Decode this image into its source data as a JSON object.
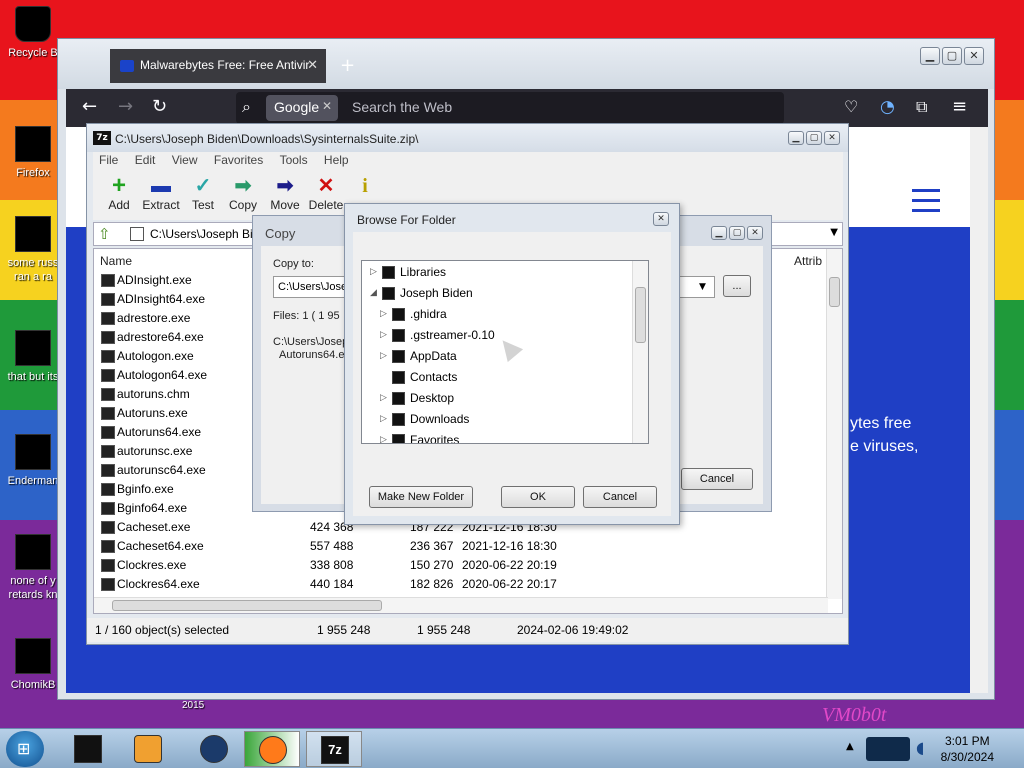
{
  "desktop": {
    "icons": [
      {
        "label": "Recycle B"
      },
      {
        "label": "Firefox"
      },
      {
        "label": "some russ ran a ra"
      },
      {
        "label": "that but its"
      },
      {
        "label": "Enderman"
      },
      {
        "label": "none of y retards kn"
      },
      {
        "label": "ChomikB"
      }
    ],
    "bg_text": "VM0b0t",
    "bg_text2": "2015"
  },
  "browser": {
    "tab_title": "Malwarebytes Free: Free Antivir",
    "tab_close": "✕",
    "new_tab": "+",
    "search_engine": "Google",
    "search_placeholder": "Search the Web",
    "site_text_line1": "ytes free",
    "site_text_line2": "e viruses,",
    "colors": {
      "site_blue": "#1f3fc5",
      "toolbar": "#2b2a33"
    }
  },
  "zip": {
    "title": "C:\\Users\\Joseph Biden\\Downloads\\SysinternalsSuite.zip\\",
    "logo": "7z",
    "menu": [
      "File",
      "Edit",
      "View",
      "Favorites",
      "Tools",
      "Help"
    ],
    "toolbar": [
      {
        "label": "Add",
        "icon": "+",
        "color": "#1fa31f"
      },
      {
        "label": "Extract",
        "icon": "▬",
        "color": "#1c3ab0"
      },
      {
        "label": "Test",
        "icon": "✓",
        "color": "#2aa6a6"
      },
      {
        "label": "Copy",
        "icon": "➡",
        "color": "#2a9a6a"
      },
      {
        "label": "Move",
        "icon": "➡",
        "color": "#1c1c8a"
      },
      {
        "label": "Delete",
        "icon": "✕",
        "color": "#d01010"
      },
      {
        "label": "Info",
        "icon": "i",
        "color": "#b8a000"
      }
    ],
    "path": "C:\\Users\\Joseph Bide",
    "columns": {
      "name": "Name",
      "attrib": "Attrib"
    },
    "files": [
      {
        "name": "ADInsight.exe",
        "size": "",
        "packed": "",
        "modified": ""
      },
      {
        "name": "ADInsight64.exe",
        "size": "",
        "packed": "",
        "modified": ""
      },
      {
        "name": "adrestore.exe",
        "size": "",
        "packed": "",
        "modified": ""
      },
      {
        "name": "adrestore64.exe",
        "size": "",
        "packed": "",
        "modified": ""
      },
      {
        "name": "Autologon.exe",
        "size": "",
        "packed": "",
        "modified": ""
      },
      {
        "name": "Autologon64.exe",
        "size": "",
        "packed": "",
        "modified": ""
      },
      {
        "name": "autoruns.chm",
        "size": "",
        "packed": "",
        "modified": ""
      },
      {
        "name": "Autoruns.exe",
        "size": "",
        "packed": "",
        "modified": ""
      },
      {
        "name": "Autoruns64.exe",
        "size": "",
        "packed": "",
        "modified": ""
      },
      {
        "name": "autorunsc.exe",
        "size": "",
        "packed": "",
        "modified": ""
      },
      {
        "name": "autorunsc64.exe",
        "size": "",
        "packed": "",
        "modified": ""
      },
      {
        "name": "Bginfo.exe",
        "size": "",
        "packed": "",
        "modified": ""
      },
      {
        "name": "Bginfo64.exe",
        "size": "",
        "packed": "",
        "modified": ""
      },
      {
        "name": "Cacheset.exe",
        "size": "424 368",
        "packed": "187 222",
        "modified": "2021-12-16 18:30"
      },
      {
        "name": "Cacheset64.exe",
        "size": "557 488",
        "packed": "236 367",
        "modified": "2021-12-16 18:30"
      },
      {
        "name": "Clockres.exe",
        "size": "338 808",
        "packed": "150 270",
        "modified": "2020-06-22 20:19"
      },
      {
        "name": "Clockres64.exe",
        "size": "440 184",
        "packed": "182 826",
        "modified": "2020-06-22 20:17"
      }
    ],
    "status": {
      "selected": "1 / 160 object(s) selected",
      "size": "1 955 248",
      "packed": "1 955 248",
      "date": "2024-02-06 19:49:02"
    }
  },
  "copy_dialog": {
    "title": "Copy",
    "copy_to_label": "Copy to:",
    "copy_to_value": "C:\\Users\\Jose",
    "files_label": "Files: 1   ( 1 95",
    "path_line1": "C:\\Users\\Josep",
    "path_line2": "Autoruns64.ex",
    "browse_btn": "...",
    "cancel": "Cancel"
  },
  "browse_dialog": {
    "title": "Browse For Folder",
    "tree": [
      {
        "label": "Libraries",
        "indent": 0,
        "arrow": "▷"
      },
      {
        "label": "Joseph Biden",
        "indent": 0,
        "arrow": "◢"
      },
      {
        "label": ".ghidra",
        "indent": 1,
        "arrow": "▷"
      },
      {
        "label": ".gstreamer-0.10",
        "indent": 1,
        "arrow": "▷"
      },
      {
        "label": "AppData",
        "indent": 1,
        "arrow": "▷"
      },
      {
        "label": "Contacts",
        "indent": 1,
        "arrow": ""
      },
      {
        "label": "Desktop",
        "indent": 1,
        "arrow": "▷"
      },
      {
        "label": "Downloads",
        "indent": 1,
        "arrow": "▷"
      },
      {
        "label": "Favorites",
        "indent": 1,
        "arrow": "▷"
      }
    ],
    "make_new_folder": "Make New Folder",
    "ok": "OK",
    "cancel": "Cancel"
  },
  "taskbar": {
    "time": "3:01 PM",
    "date": "8/30/2024",
    "logo7z": "7z"
  }
}
